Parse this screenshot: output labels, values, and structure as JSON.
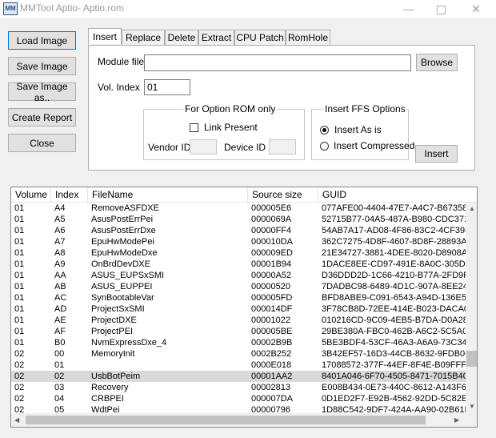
{
  "window": {
    "title": "MMTool Aptio- Aptio.rom",
    "icon_text": "MM",
    "minimize": "—",
    "close": "✕"
  },
  "buttons": {
    "load": "Load Image",
    "save": "Save Image",
    "save_as": "Save Image as..",
    "report": "Create Report",
    "close": "Close"
  },
  "tabs": [
    "Insert",
    "Replace",
    "Delete",
    "Extract",
    "CPU Patch",
    "RomHole"
  ],
  "insert": {
    "module_file_label": "Module file",
    "module_file_value": "",
    "browse": "Browse",
    "vol_index_label": "Vol. Index",
    "vol_index_value": "01",
    "option_rom_title": "For Option ROM only",
    "link_present": "Link Present",
    "vendor_id": "Vendor ID",
    "device_id": "Device ID",
    "ffs_title": "Insert FFS Options",
    "insert_as_is": "Insert As is",
    "insert_compressed": "Insert Compressed",
    "insert_button": "Insert"
  },
  "table": {
    "columns": [
      "Volume",
      "Index",
      "FileName",
      "Source size",
      "GUID"
    ],
    "selected_row": 15,
    "rows": [
      [
        "01",
        "A4",
        "RemoveASFDXE",
        "000005E6",
        "077AFE00-4404-47E7-A4C7-B673580"
      ],
      [
        "01",
        "A5",
        "AsusPostErrPei",
        "0000069A",
        "52715B77-04A5-487A-B980-CDC371"
      ],
      [
        "01",
        "A6",
        "AsusPostErrDxe",
        "00000FF4",
        "54AB7A17-AD08-4F86-83C2-4CF398"
      ],
      [
        "01",
        "A7",
        "EpuHwModePei",
        "000010DA",
        "362C7275-4D8F-4607-8D8F-28893A"
      ],
      [
        "01",
        "A8",
        "EpuHwModeDxe",
        "000009ED",
        "21E34727-3881-4DEE-8020-D8908A"
      ],
      [
        "01",
        "A9",
        "OnBrdDevDXE",
        "00001B94",
        "1DACE8EE-CD97-491E-8A0C-305D6"
      ],
      [
        "01",
        "AA",
        "ASUS_EUPSxSMI",
        "00000A52",
        "D36DDD2D-1C66-4210-B77A-2FD9F"
      ],
      [
        "01",
        "AB",
        "ASUS_EUPPEI",
        "00000520",
        "7DADBC98-6489-4D1C-907A-8EE24"
      ],
      [
        "01",
        "AC",
        "SynBootableVar",
        "000005FD",
        "BFD8ABE9-C091-6543-A94D-136E5B"
      ],
      [
        "01",
        "AD",
        "ProjectSxSMI",
        "000014DF",
        "3F78CB8D-72EE-414E-B023-DACA0"
      ],
      [
        "01",
        "AE",
        "ProjectDXE",
        "00001022",
        "010216CD-9C09-4EB5-B7DA-D0A28"
      ],
      [
        "01",
        "AF",
        "ProjectPEI",
        "000005BE",
        "29BE380A-FBC0-462B-A6C2-5C5A07"
      ],
      [
        "01",
        "B0",
        "NvmExpressDxe_4",
        "00002B9B",
        "5BE3BDF4-53CF-46A3-A6A9-73C344"
      ],
      [
        "02",
        "00",
        "MemoryInit",
        "0002B252",
        "3B42EF57-16D3-44CB-8632-9FDB06"
      ],
      [
        "02",
        "01",
        "",
        "0000E018",
        "17088572-377F-44EF-8F4E-B09FFF4"
      ],
      [
        "02",
        "02",
        "UsbBotPeim",
        "00001AA2",
        "8401A046-6F70-4505-8471-7015B40"
      ],
      [
        "02",
        "03",
        "Recovery",
        "00002813",
        "E008B434-0E73-440C-8612-A143F6"
      ],
      [
        "02",
        "04",
        "CRBPEI",
        "000007DA",
        "0D1ED2F7-E92B-4562-92DD-5C82E"
      ],
      [
        "02",
        "05",
        "WdtPei",
        "00000796",
        "1D88C542-9DF7-424A-AA90-02B61F"
      ]
    ]
  }
}
